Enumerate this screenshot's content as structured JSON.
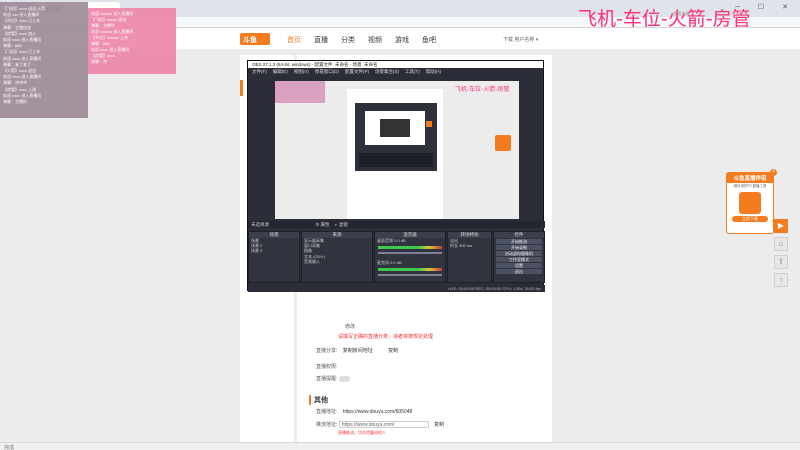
{
  "browser": {
    "tab_title": "直播设置",
    "window_controls": "─ ☐ ✕"
  },
  "site": {
    "logo": "斗鱼",
    "nav": [
      "首页",
      "直播",
      "分类",
      "视频",
      "游戏",
      "鱼吧"
    ],
    "nav_active_index": 0,
    "user_text": "下载   用户名称 ▾",
    "banner_text": "飞机-车位-火箭-房管",
    "banner_mini": "直播工具"
  },
  "settings": {
    "page_title": "直播设置",
    "notice_label": "修改",
    "warning": "请填写正确的直播分类，违者将按规定处理",
    "share_label": "直播分享:",
    "share_value": "复制房间地址",
    "share_button": "复制",
    "sub_label": "直播权限:",
    "toggle_label": "直播提醒:",
    "section_title": "其他",
    "addr_label": "直播地址:",
    "addr_value": "https://www.douyu.com/605048",
    "stream_label": "推流地址:",
    "stream_value": "https://www.douyu.com/",
    "stream_button": "复制",
    "stream_hint": "直播推流，切勿泄露给他人"
  },
  "overlay_left": [
    "【飞机】xxxx 送出 火箭",
    "欢迎 xxx 进入直播间",
    "【车位】xxxx 已上车",
    "弹幕：主播加油",
    "【房管】xxxx 加入",
    "欢迎 xxxx 进入直播间",
    "弹幕：666",
    "【飞机】xxxx 已上车",
    "欢迎 xxxx 进入直播间",
    "弹幕：来了来了",
    "【火箭】xxxx 送出",
    "欢迎 xxxx 进入直播间",
    "弹幕：冲冲冲",
    "【房管】xxxx 上线",
    "欢迎 xxxx 进入直播间",
    "弹幕：主播好"
  ],
  "overlay_pink": [
    "欢迎 xxxxxx 进入直播间",
    "【飞机】xxxxx 送出",
    "弹幕：主播牛",
    "欢迎 xxxxxx 进入直播间",
    "【车位】xxxxxx 上车",
    "弹幕：666",
    "欢迎 xxxx 进入直播间",
    "【房管】xxxx",
    "弹幕：冲"
  ],
  "obs": {
    "title": "OBS 27.1.3 (64-bit, windows) - 配置文件: 未命名 - 场景: 未命名",
    "menu": [
      "文件(F)",
      "编辑(E)",
      "视图(V)",
      "停靠窗口(D)",
      "配置文件(P)",
      "场景集合(S)",
      "工具(T)",
      "帮助(H)"
    ],
    "bar_left": "未选择源",
    "bar_props": "⚙ 属性",
    "bar_filter": "◐ 滤镜",
    "docks": {
      "scenes_title": "场景",
      "scenes": [
        "场景",
        "场景 2",
        "场景 3"
      ],
      "sources_title": "来源",
      "sources": [
        "显示器采集",
        "窗口采集",
        "图像",
        "文本 (GDI+)",
        "音频输入"
      ],
      "mixer_title": "混音器",
      "mixer": [
        "桌面音频  0.0 dB",
        "麦克风  0.0 dB"
      ],
      "transitions_title": "转场特效",
      "transitions": [
        "淡出",
        "时长  300 ms"
      ],
      "controls_title": "控件",
      "controls": [
        "开始推流",
        "开始录制",
        "启动虚拟摄像机",
        "工作室模式",
        "设置",
        "退出"
      ]
    },
    "status": "LIVE: 00:00:00   REC: 00:00:00   CPU: 1.8%, 30.00 fps"
  },
  "promo": {
    "title": "斗鱼直播伴侣",
    "subtitle": "超好用的PC直播工具",
    "button": "立即下载",
    "close": "×"
  },
  "status_bar": "完成",
  "colors": {
    "brand": "#f57b1f",
    "banner": "#ff2d78",
    "link": "#3b7fd4",
    "warning": "#f03030"
  }
}
